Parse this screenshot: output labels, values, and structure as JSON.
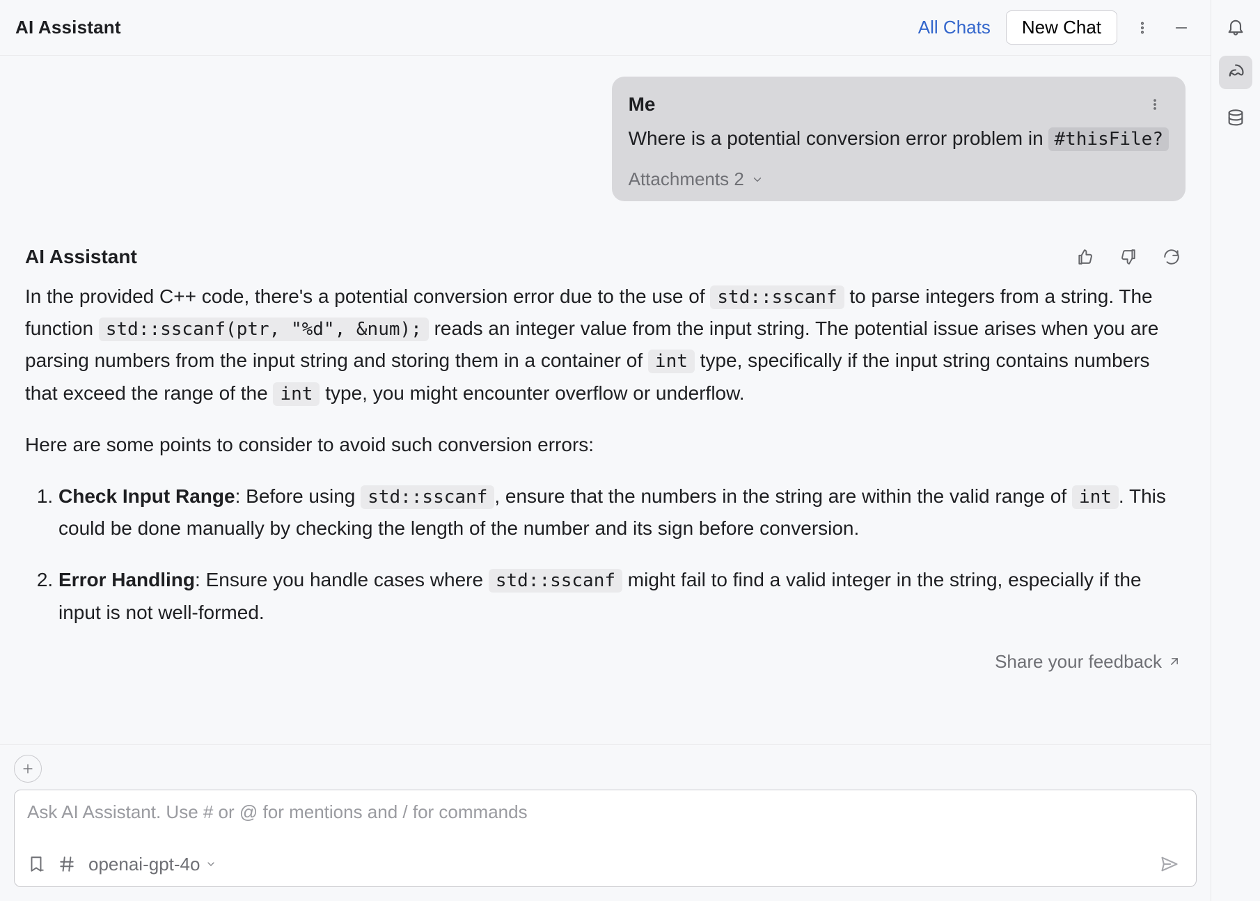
{
  "header": {
    "title": "AI Assistant",
    "all_chats": "All Chats",
    "new_chat": "New Chat"
  },
  "user_message": {
    "sender": "Me",
    "text_prefix": "Where is a potential conversion error problem in ",
    "file_ref": "#thisFile?",
    "attachments_label": "Attachments 2"
  },
  "assistant": {
    "name": "AI Assistant",
    "p1_a": "In the provided C++ code, there's a potential conversion error due to the use of ",
    "p1_code1": "std::sscanf",
    "p1_b": " to parse integers from a string. The function ",
    "p1_code2": "std::sscanf(ptr, \"%d\", &num);",
    "p1_c": " reads an integer value from the input string. The potential issue arises when you are parsing numbers from the input string and storing them in a container of ",
    "p1_code3": "int",
    "p1_d": " type, specifically if the input string contains numbers that exceed the range of the ",
    "p1_code4": "int",
    "p1_e": " type, you might encounter overflow or underflow.",
    "p2": "Here are some points to consider to avoid such conversion errors:",
    "li1_title": "Check Input Range",
    "li1_a": ": Before using ",
    "li1_code1": "std::sscanf",
    "li1_b": ", ensure that the numbers in the string are within the valid range of ",
    "li1_code2": "int",
    "li1_c": ". This could be done manually by checking the length of the number and its sign before conversion.",
    "li2_title": "Error Handling",
    "li2_a": ": Ensure you handle cases where ",
    "li2_code1": "std::sscanf",
    "li2_b": " might fail to find a valid integer in the string, especially if the input is not well-formed."
  },
  "feedback": {
    "label": "Share your feedback"
  },
  "composer": {
    "placeholder": "Ask AI Assistant. Use # or @ for mentions and / for commands",
    "model": "openai-gpt-4o"
  }
}
